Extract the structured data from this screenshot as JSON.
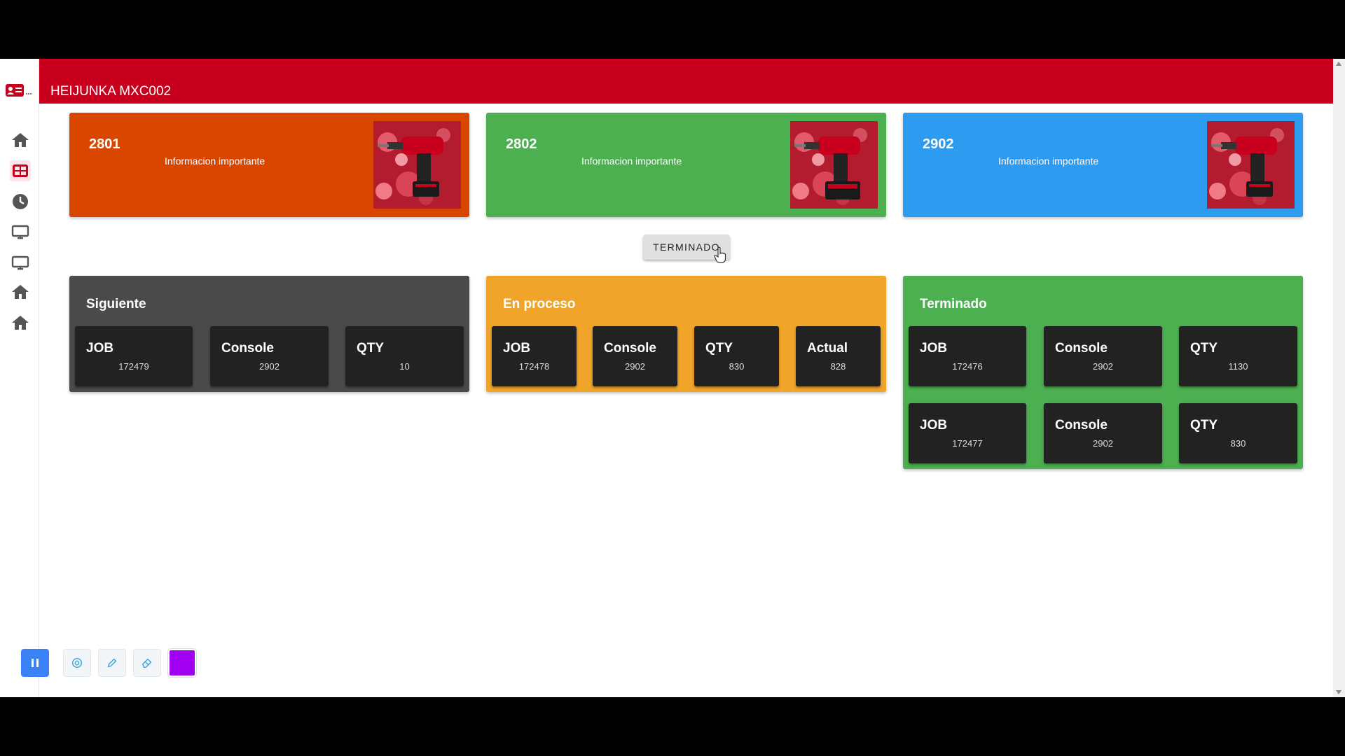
{
  "app": {
    "title": "HEIJUNKA MXC002"
  },
  "colors": {
    "header": "#c8001e",
    "orange": "#d84600",
    "green": "#4caf50",
    "blue": "#2d9bef",
    "dark": "#4a4a4a",
    "amber": "#f0a52a",
    "tile": "#222222",
    "pen": "#a100f0"
  },
  "sidebar": {
    "logo": "id-card-icon",
    "items": [
      {
        "icon": "home-icon"
      },
      {
        "icon": "dashboard-icon",
        "active": true
      },
      {
        "icon": "clock-icon"
      },
      {
        "icon": "monitor-icon"
      },
      {
        "icon": "monitor-icon"
      },
      {
        "icon": "home-icon"
      },
      {
        "icon": "home-icon"
      }
    ]
  },
  "cards": [
    {
      "number": "2801",
      "subtitle": "Informacion importante",
      "image": "drill-image"
    },
    {
      "number": "2802",
      "subtitle": "Informacion importante",
      "image": "drill-image"
    },
    {
      "number": "2902",
      "subtitle": "Informacion importante",
      "image": "drill-image"
    }
  ],
  "action_button": {
    "label": "TERMINADO"
  },
  "panels": {
    "siguiente": {
      "title": "Siguiente",
      "tiles": [
        {
          "label": "JOB",
          "value": "172479"
        },
        {
          "label": "Console",
          "value": "2902"
        },
        {
          "label": "QTY",
          "value": "10"
        }
      ]
    },
    "en_proceso": {
      "title": "En proceso",
      "tiles": [
        {
          "label": "JOB",
          "value": "172478"
        },
        {
          "label": "Console",
          "value": "2902"
        },
        {
          "label": "QTY",
          "value": "830"
        },
        {
          "label": "Actual",
          "value": "828"
        }
      ]
    },
    "terminado": {
      "title": "Terminado",
      "rows": [
        [
          {
            "label": "JOB",
            "value": "172476"
          },
          {
            "label": "Console",
            "value": "2902"
          },
          {
            "label": "QTY",
            "value": "1130"
          }
        ],
        [
          {
            "label": "JOB",
            "value": "172477"
          },
          {
            "label": "Console",
            "value": "2902"
          },
          {
            "label": "QTY",
            "value": "830"
          }
        ]
      ]
    }
  },
  "annotation_toolbar": {
    "tools": [
      "pause-icon",
      "pointer-icon",
      "pencil-icon",
      "eraser-icon",
      "color-swatch"
    ]
  }
}
